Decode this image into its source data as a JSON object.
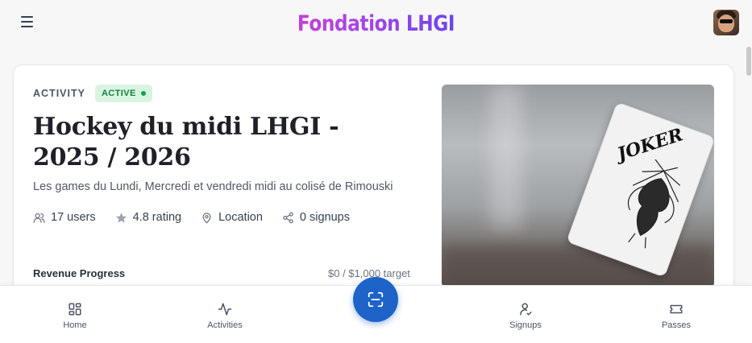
{
  "header": {
    "brand": "Fondation LHGI",
    "menu_icon": "hamburger-icon",
    "avatar_alt": "user-avatar"
  },
  "activity": {
    "eyebrow": "ACTIVITY",
    "status": "ACTIVE",
    "title": "Hockey du midi LHGI - 2025 / 2026",
    "description": "Les games du Lundi, Mercredi et vendredi midi au colisé de Rimouski",
    "stats": {
      "users": "17 users",
      "rating": "4.8 rating",
      "location": "Location",
      "signups": "0 signups"
    },
    "revenue": {
      "label": "Revenue Progress",
      "value": "$0 / $1,000 target"
    },
    "image_card_text": "JOKER"
  },
  "nav": {
    "items": [
      {
        "label": "Home",
        "icon": "grid-icon"
      },
      {
        "label": "Activities",
        "icon": "activity-icon"
      },
      {
        "label": "Signups",
        "icon": "user-check-icon"
      },
      {
        "label": "Passes",
        "icon": "ticket-icon"
      }
    ],
    "fab_icon": "scan-icon"
  },
  "colors": {
    "accent": "#1d63c8",
    "badge_bg": "#d9f5e1",
    "badge_text": "#16803c",
    "brand_gradient_start": "#c43fd9",
    "brand_gradient_end": "#6d45e8"
  }
}
